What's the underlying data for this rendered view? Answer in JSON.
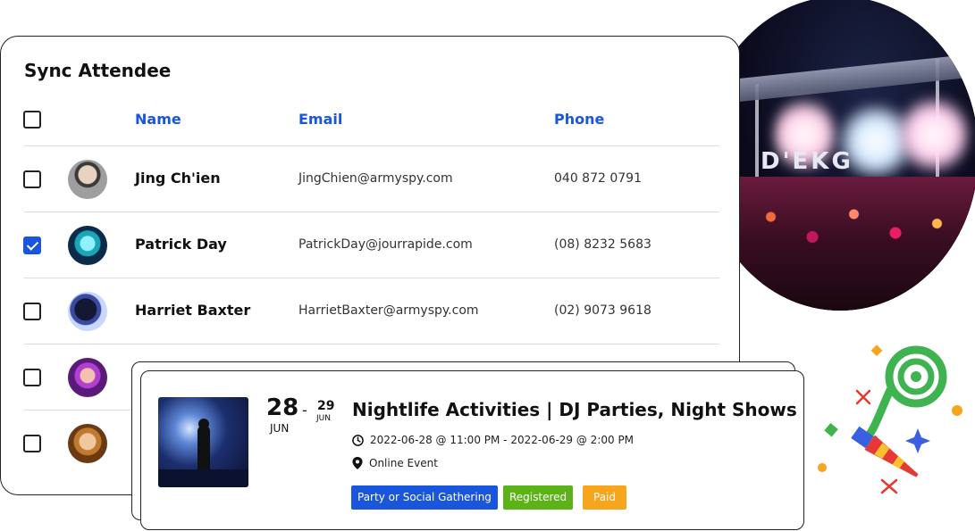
{
  "card": {
    "title": "Sync Attendee",
    "columns": {
      "name": "Name",
      "email": "Email",
      "phone": "Phone"
    },
    "rows": [
      {
        "name": "Jing Ch'ien",
        "email": "JingChien@armyspy.com",
        "phone": "040 872 0791",
        "checked": false
      },
      {
        "name": "Patrick Day",
        "email": "PatrickDay@jourrapide.com",
        "phone": "(08) 8232 5683",
        "checked": true
      },
      {
        "name": "Harriet Baxter",
        "email": "HarrietBaxter@armyspy.com",
        "phone": "(02) 9073 9618",
        "checked": false
      },
      {
        "name": "",
        "email": "",
        "phone": "",
        "checked": false
      },
      {
        "name": "",
        "email": "",
        "phone": "",
        "checked": false
      }
    ]
  },
  "event": {
    "start_day": "28",
    "start_month": "JUN",
    "separator": "-",
    "end_day": "29",
    "end_month": "JUN",
    "title": "Nightlife Activities | DJ Parties, Night Shows",
    "datetime": "2022-06-28 @ 11:00 PM - 2022-06-29 @ 2:00 PM",
    "location": "Online Event",
    "badges": [
      {
        "label": "Party or Social Gathering",
        "color": "#1a56db"
      },
      {
        "label": "Registered",
        "color": "#5cb318"
      },
      {
        "label": "Paid",
        "color": "#f7a51c"
      }
    ]
  },
  "colors": {
    "accent": "#1a56db",
    "green": "#5cb318",
    "orange": "#f7a51c"
  }
}
